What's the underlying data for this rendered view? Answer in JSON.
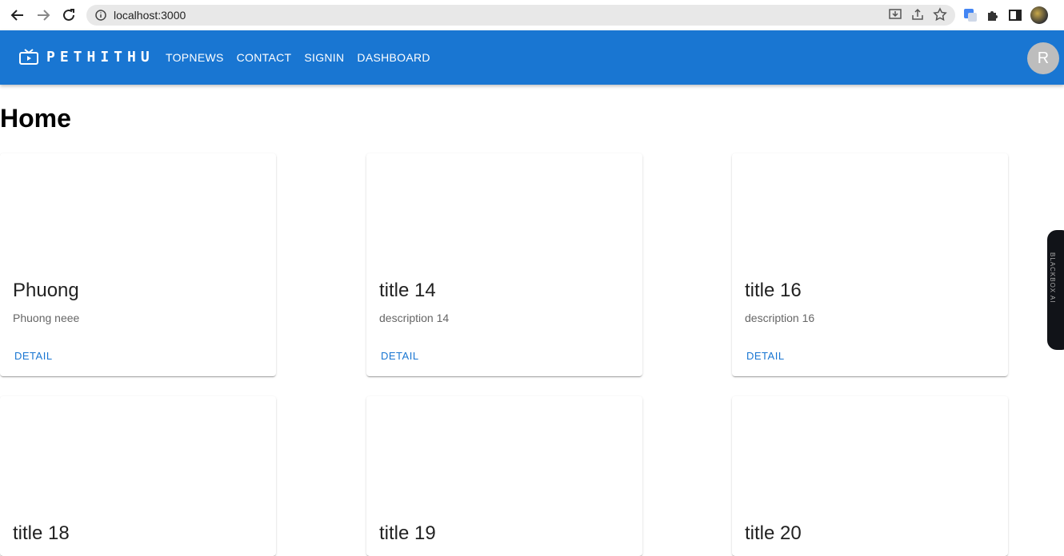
{
  "browser": {
    "url": "localhost:3000"
  },
  "appbar": {
    "brand": "PETHITHU",
    "menu": [
      "TOPNEWS",
      "CONTACT",
      "SIGNIN",
      "DASHBOARD"
    ],
    "avatar_letter": "R",
    "color": "#1976d2"
  },
  "page": {
    "title": "Home"
  },
  "cards": [
    {
      "title": "Phuong",
      "description": "Phuong neee",
      "button": "DETAIL"
    },
    {
      "title": "title 14",
      "description": "description 14",
      "button": "DETAIL"
    },
    {
      "title": "title 16",
      "description": "description 16",
      "button": "DETAIL"
    },
    {
      "title": "title 18"
    },
    {
      "title": "title 19"
    },
    {
      "title": "title 20"
    }
  ],
  "side_tab": {
    "label": "BLACKBOX AI"
  }
}
